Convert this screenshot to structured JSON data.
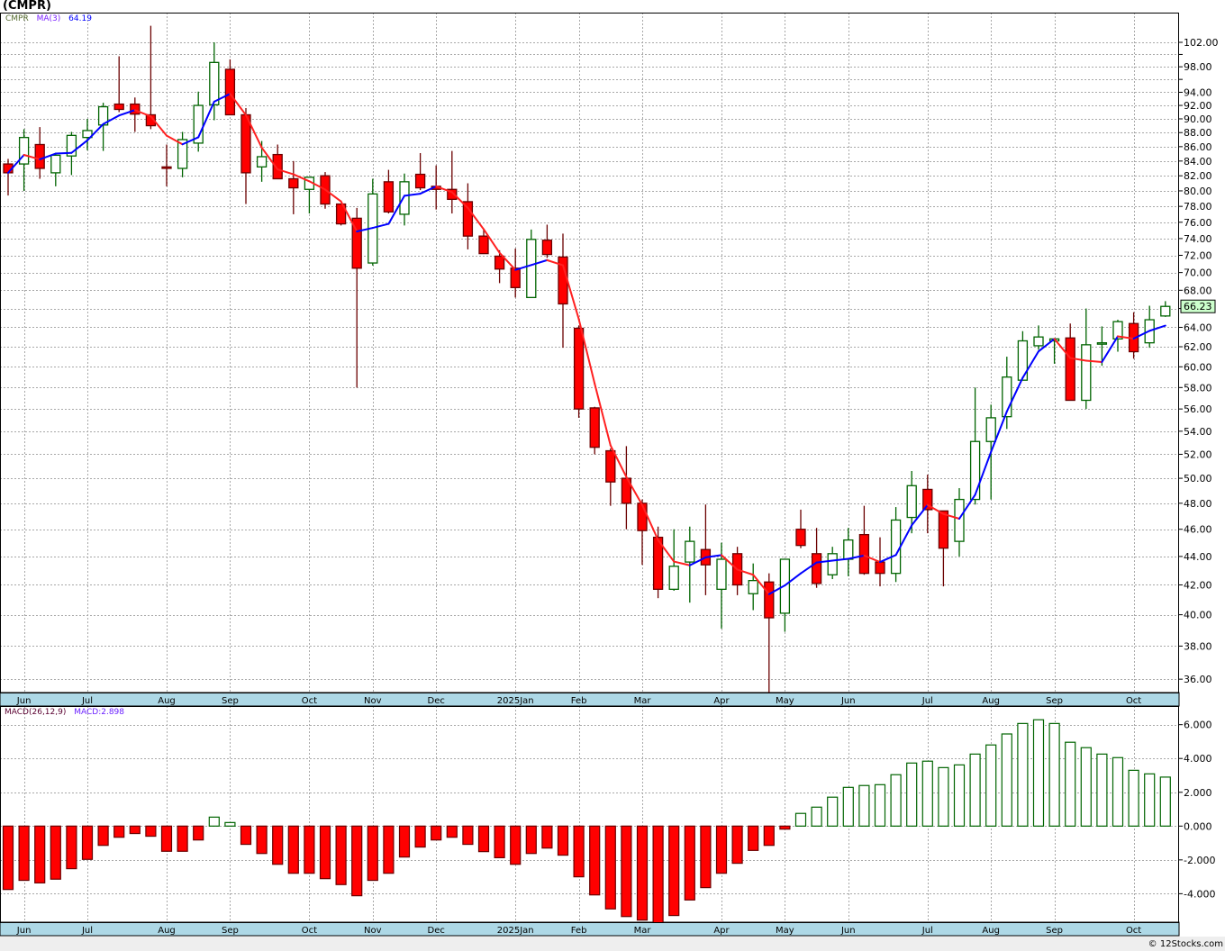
{
  "title": "(CMPR)",
  "legend": {
    "symbol": "CMPR",
    "ma_label": "MA(3)",
    "ma_value": "64.19"
  },
  "macd_legend": {
    "label": "MACD(26,12,9)",
    "value": "MACD:2.898"
  },
  "last_price": "66.23",
  "footer": "© 12Stocks.com",
  "colors": {
    "up": "#006400",
    "down_fill": "#ff0000",
    "down_border": "#6b0000",
    "ma_up": "#0000ff",
    "ma_down": "#ff2020",
    "date_band": "#add8e6",
    "last_price_bg": "#ccffcc"
  },
  "chart_data": [
    {
      "type": "candlestick",
      "frequency": "weekly",
      "y_scale": "log",
      "ylim": [
        35,
        104
      ],
      "grid": true,
      "y_ticks": [
        36,
        38,
        40,
        42,
        44,
        46,
        48,
        50,
        52,
        54,
        56,
        58,
        60,
        62,
        64,
        66,
        68,
        70,
        72,
        74,
        76,
        78,
        80,
        82,
        84,
        86,
        88,
        90,
        92,
        94,
        96,
        98,
        100,
        102
      ],
      "y_tick_labels": [
        "36.00",
        "38.00",
        "40.00",
        "42.00",
        "44.00",
        "46.00",
        "48.00",
        "50.00",
        "52.00",
        "54.00",
        "56.00",
        "58.00",
        "60.00",
        "62.00",
        "64.00",
        "",
        "68.00",
        "70.00",
        "72.00",
        "74.00",
        "76.00",
        "78.00",
        "80.00",
        "82.00",
        "84.00",
        "86.00",
        "88.00",
        "90.00",
        "92.00",
        "94.00",
        "",
        "98.00",
        "",
        "102.00"
      ],
      "x_ticks": [
        {
          "label": "Jun",
          "index": 1
        },
        {
          "label": "Jul",
          "index": 5
        },
        {
          "label": "Aug",
          "index": 10
        },
        {
          "label": "Sep",
          "index": 14
        },
        {
          "label": "Oct",
          "index": 19
        },
        {
          "label": "Nov",
          "index": 23
        },
        {
          "label": "Dec",
          "index": 27
        },
        {
          "label": "2025Jan",
          "index": 32
        },
        {
          "label": "Feb",
          "index": 36
        },
        {
          "label": "Mar",
          "index": 40
        },
        {
          "label": "Apr",
          "index": 45
        },
        {
          "label": "May",
          "index": 49
        },
        {
          "label": "Jun",
          "index": 53
        },
        {
          "label": "Jul",
          "index": 58
        },
        {
          "label": "Aug",
          "index": 62
        },
        {
          "label": "Sep",
          "index": 66
        },
        {
          "label": "Oct",
          "index": 71
        }
      ],
      "ohlc_fields": [
        "open",
        "high",
        "low",
        "close"
      ],
      "ohlc": [
        [
          83.6,
          84.3,
          79.4,
          82.4
        ],
        [
          83.6,
          88.5,
          80.0,
          87.3
        ],
        [
          86.3,
          88.8,
          81.6,
          83.0
        ],
        [
          82.4,
          85.0,
          80.6,
          84.8
        ],
        [
          84.7,
          88.1,
          82.1,
          87.6
        ],
        [
          87.3,
          90.0,
          85.5,
          88.3
        ],
        [
          89.1,
          92.4,
          85.4,
          91.8
        ],
        [
          92.2,
          99.7,
          91.0,
          91.4
        ],
        [
          92.2,
          93.2,
          88.1,
          90.7
        ],
        [
          90.6,
          104.8,
          88.5,
          89.0
        ],
        [
          83.2,
          86.3,
          80.6,
          83.0
        ],
        [
          83.0,
          88.1,
          81.8,
          87.0
        ],
        [
          86.5,
          94.1,
          85.3,
          92.0
        ],
        [
          92.1,
          102.0,
          89.8,
          98.7
        ],
        [
          97.6,
          99.2,
          90.6,
          90.6
        ],
        [
          90.6,
          91.6,
          78.3,
          82.4
        ],
        [
          83.2,
          86.8,
          81.2,
          84.6
        ],
        [
          84.9,
          86.3,
          81.6,
          81.6
        ],
        [
          81.6,
          84.0,
          77.0,
          80.4
        ],
        [
          80.2,
          81.8,
          77.1,
          81.8
        ],
        [
          82.0,
          82.5,
          77.7,
          78.3
        ],
        [
          78.3,
          78.3,
          75.6,
          75.8
        ],
        [
          76.5,
          77.8,
          58.0,
          70.5
        ],
        [
          71.1,
          81.6,
          70.8,
          79.6
        ],
        [
          81.2,
          82.8,
          77.1,
          77.3
        ],
        [
          77.0,
          82.3,
          75.6,
          81.2
        ],
        [
          82.2,
          85.1,
          80.1,
          80.4
        ],
        [
          80.6,
          83.4,
          77.6,
          80.2
        ],
        [
          80.2,
          85.4,
          77.1,
          78.9
        ],
        [
          78.6,
          81.0,
          72.7,
          74.3
        ],
        [
          74.3,
          75.1,
          72.2,
          72.2
        ],
        [
          71.9,
          72.6,
          68.8,
          70.4
        ],
        [
          70.5,
          72.8,
          67.2,
          68.3
        ],
        [
          67.2,
          75.1,
          67.2,
          73.9
        ],
        [
          73.8,
          75.7,
          71.7,
          72.1
        ],
        [
          71.8,
          74.6,
          61.9,
          66.5
        ],
        [
          63.9,
          64.2,
          55.2,
          56.0
        ],
        [
          56.1,
          56.2,
          52.0,
          52.6
        ],
        [
          52.3,
          52.5,
          47.8,
          49.7
        ],
        [
          50.0,
          52.7,
          46.0,
          48.0
        ],
        [
          48.0,
          48.3,
          43.4,
          45.9
        ],
        [
          45.4,
          46.2,
          41.1,
          41.7
        ],
        [
          41.7,
          46.0,
          41.6,
          43.3
        ],
        [
          43.6,
          46.2,
          40.8,
          45.1
        ],
        [
          44.5,
          47.9,
          41.3,
          43.4
        ],
        [
          41.7,
          45.0,
          39.1,
          43.8
        ],
        [
          44.2,
          44.7,
          41.3,
          42.0
        ],
        [
          41.4,
          43.5,
          40.3,
          42.3
        ],
        [
          42.2,
          42.8,
          34.8,
          39.8
        ],
        [
          40.1,
          43.8,
          38.9,
          43.8
        ],
        [
          46.0,
          47.5,
          44.6,
          44.8
        ],
        [
          44.2,
          46.1,
          41.8,
          42.1
        ],
        [
          42.7,
          44.7,
          42.4,
          44.2
        ],
        [
          43.8,
          46.1,
          42.6,
          45.2
        ],
        [
          45.6,
          47.8,
          42.7,
          42.8
        ],
        [
          43.6,
          45.4,
          41.9,
          42.8
        ],
        [
          42.8,
          47.7,
          42.2,
          46.7
        ],
        [
          46.9,
          50.6,
          45.7,
          49.4
        ],
        [
          49.1,
          50.3,
          45.7,
          47.5
        ],
        [
          47.4,
          47.4,
          41.9,
          44.6
        ],
        [
          45.1,
          49.2,
          44.0,
          48.3
        ],
        [
          48.3,
          58.0,
          47.9,
          53.1
        ],
        [
          53.1,
          56.4,
          48.3,
          55.2
        ],
        [
          55.3,
          61.0,
          54.2,
          59.0
        ],
        [
          58.7,
          63.6,
          58.7,
          62.6
        ],
        [
          62.1,
          64.2,
          61.7,
          63.0
        ],
        [
          62.6,
          62.8,
          60.3,
          62.8
        ],
        [
          62.9,
          64.4,
          56.8,
          56.8
        ],
        [
          56.8,
          66.0,
          56.0,
          62.2
        ],
        [
          62.3,
          64.1,
          60.1,
          62.4
        ],
        [
          62.8,
          64.8,
          61.5,
          64.6
        ],
        [
          64.4,
          65.6,
          60.8,
          61.5
        ],
        [
          62.4,
          66.3,
          61.9,
          64.8
        ],
        [
          65.2,
          66.8,
          65.1,
          66.23
        ]
      ],
      "overlay": {
        "name": "MA(3)",
        "period": 3,
        "last": 64.19
      }
    },
    {
      "type": "bar",
      "title": "MACD(26,12,9)",
      "ylim": [
        -5.8,
        6.6
      ],
      "grid": true,
      "y_ticks": [
        -4,
        -2,
        0,
        2,
        4,
        6
      ],
      "y_tick_labels": [
        "-4.000",
        "-2.000",
        "0.000",
        "2.000",
        "4.000",
        "6.000"
      ],
      "values": [
        -3.75,
        -3.21,
        -3.36,
        -3.14,
        -2.52,
        -1.97,
        -1.14,
        -0.66,
        -0.44,
        -0.6,
        -1.49,
        -1.49,
        -0.82,
        0.53,
        0.21,
        -1.08,
        -1.62,
        -2.26,
        -2.79,
        -2.79,
        -3.11,
        -3.46,
        -4.12,
        -3.21,
        -2.79,
        -1.83,
        -1.24,
        -0.82,
        -0.66,
        -1.08,
        -1.51,
        -1.87,
        -2.26,
        -1.62,
        -1.3,
        -1.72,
        -3.0,
        -4.07,
        -4.9,
        -5.35,
        -5.56,
        -5.9,
        -5.29,
        -4.37,
        -3.64,
        -2.79,
        -2.2,
        -1.44,
        -1.14,
        -0.18,
        0.75,
        1.12,
        1.71,
        2.29,
        2.4,
        2.45,
        3.04,
        3.73,
        3.84,
        3.46,
        3.62,
        4.26,
        4.8,
        5.45,
        6.07,
        6.29,
        6.07,
        4.96,
        4.64,
        4.26,
        4.05,
        3.3,
        3.09,
        2.898
      ]
    }
  ]
}
